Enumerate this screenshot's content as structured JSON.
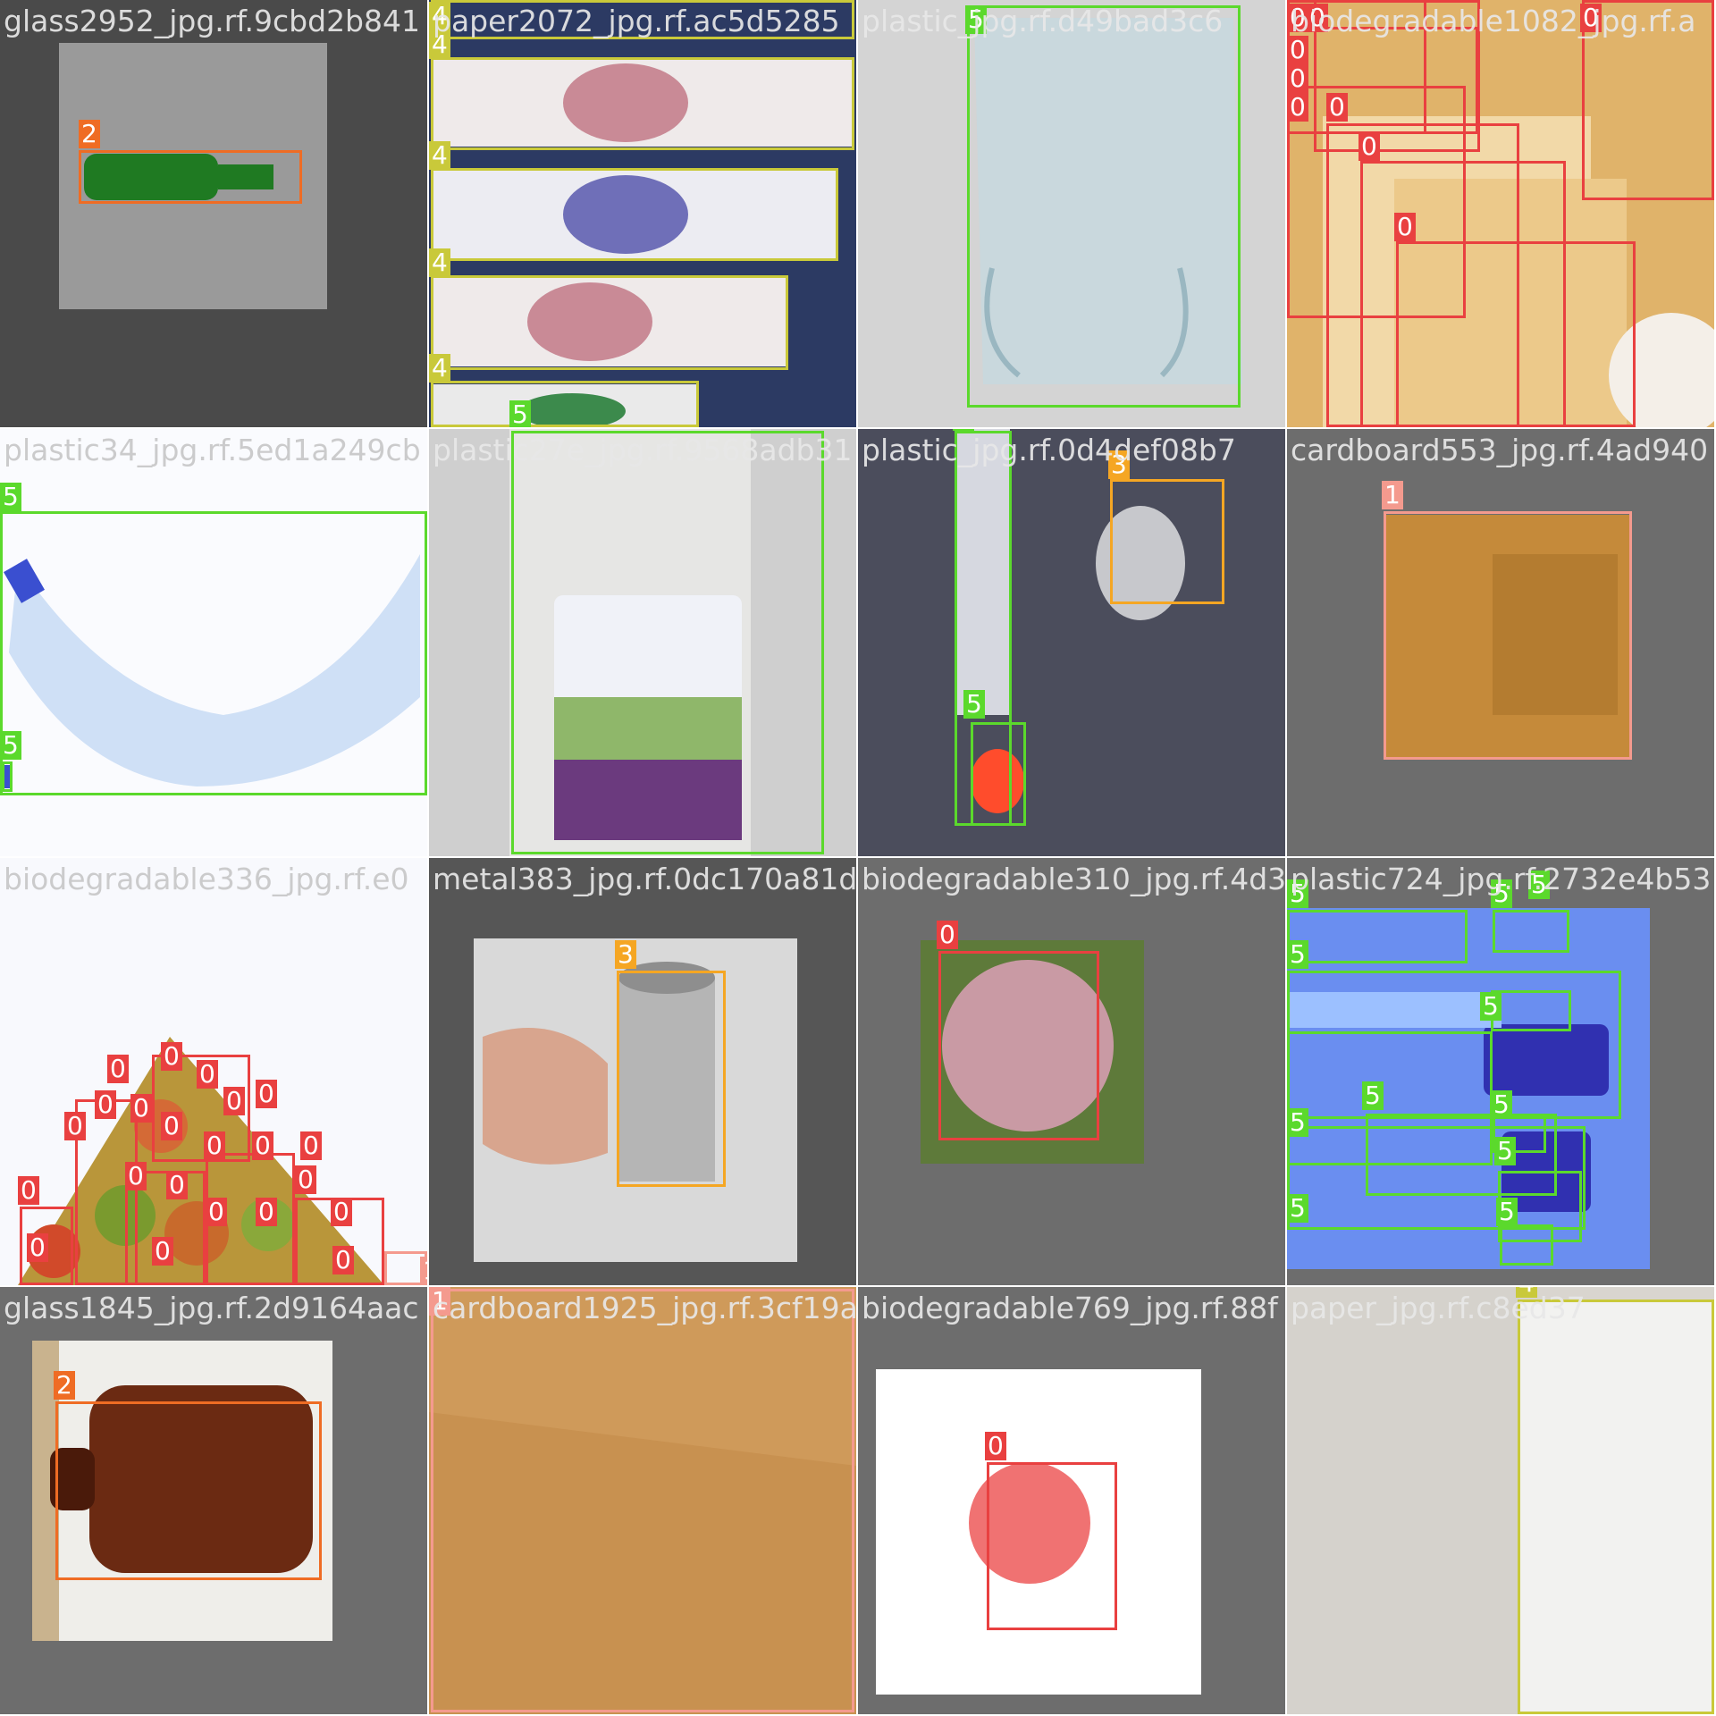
{
  "mosaic": {
    "tiles": [
      {
        "filename": "glass2952_jpg.rf.9cbd2b841",
        "labels": [
          "2"
        ]
      },
      {
        "filename": "paper2072_jpg.rf.ac5d5285",
        "labels": [
          "4",
          "4",
          "4",
          "4",
          "4",
          "5"
        ]
      },
      {
        "filename": "plastic_jpg.rf.d49bad3c6",
        "labels": [
          "5"
        ]
      },
      {
        "filename": "biodegradable1082_jpg.rf.a",
        "labels": [
          "0",
          "0",
          "0",
          "0",
          "0",
          "0",
          "0",
          "0",
          "0"
        ]
      },
      {
        "filename": "plastic34_jpg.rf.5ed1a249cb",
        "labels": [
          "5",
          "5"
        ]
      },
      {
        "filename": "plastic27e_jpg.rf.9568adb31",
        "labels": [
          "5"
        ]
      },
      {
        "filename": "plastic_jpg.rf.0d4def08b7",
        "labels": [
          "5",
          "5",
          "3"
        ]
      },
      {
        "filename": "cardboard553_jpg.rf.4ad940",
        "labels": [
          "1"
        ]
      },
      {
        "filename": "biodegradable336_jpg.rf.e0",
        "labels": [
          "0",
          "0",
          "0",
          "0",
          "0",
          "0",
          "0",
          "0",
          "0",
          "0",
          "0",
          "0",
          "0",
          "0",
          "0",
          "0",
          "0",
          "0",
          "0",
          "0",
          "0",
          "0",
          "1"
        ]
      },
      {
        "filename": "metal383_jpg.rf.0dc170a81d65",
        "labels": [
          "3"
        ]
      },
      {
        "filename": "biodegradable310_jpg.rf.4d3",
        "labels": [
          "0"
        ]
      },
      {
        "filename": "plastic724_jpg.rf.2732e4b53",
        "labels": [
          "5",
          "5",
          "5",
          "5",
          "5",
          "5",
          "5",
          "5",
          "5",
          "5",
          "5"
        ]
      },
      {
        "filename": "glass1845_jpg.rf.2d9164aac",
        "labels": [
          "2"
        ]
      },
      {
        "filename": "cardboard1925_jpg.rf.3cf19a",
        "labels": [
          "1"
        ]
      },
      {
        "filename": "biodegradable769_jpg.rf.88f",
        "labels": [
          "0"
        ]
      },
      {
        "filename": "paper_jpg.rf.c8ed37",
        "labels": [
          "4"
        ]
      }
    ]
  },
  "colors": {
    "class0": "#e94040",
    "class1": "#f49a8e",
    "class2": "#ef6c24",
    "class3": "#f5a623",
    "class4": "#c9c93a",
    "class5": "#5bd92c"
  }
}
